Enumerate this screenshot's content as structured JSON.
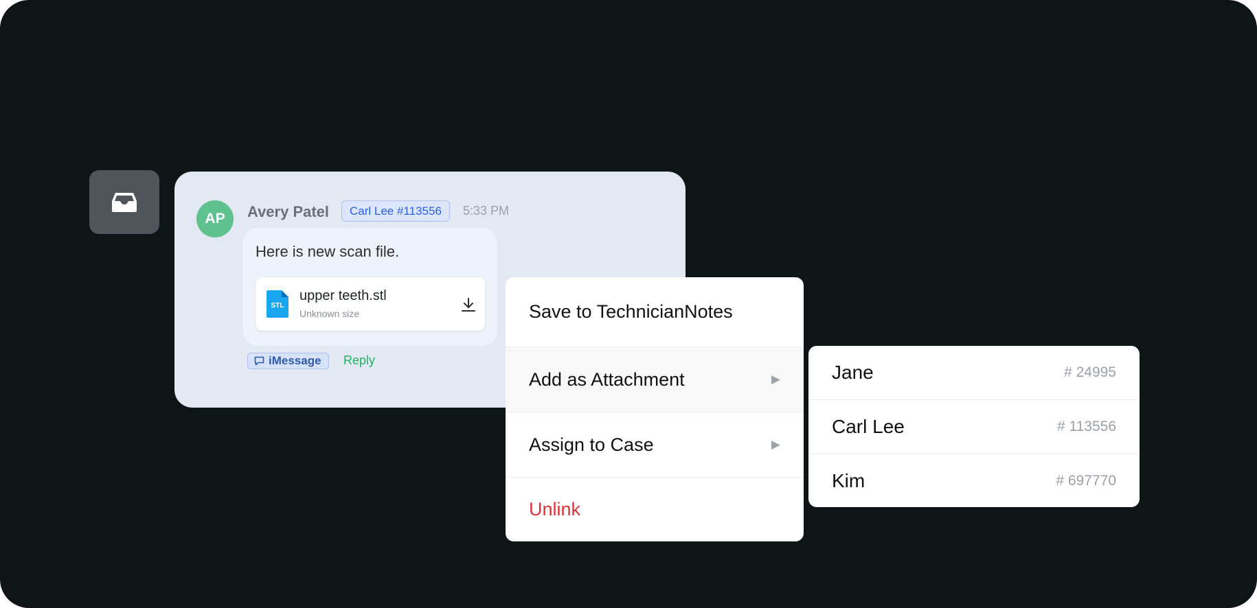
{
  "sidebar": {
    "icon": "inbox-tray-icon"
  },
  "message": {
    "avatar_initials": "AP",
    "sender": "Avery Patel",
    "case_tag": "Carl Lee #113556",
    "time": "5:33 PM",
    "text": "Here is new scan file.",
    "attachment": {
      "type_label": "STL",
      "name": "upper teeth.stl",
      "size": "Unknown size"
    },
    "channel": "iMessage",
    "reply_label": "Reply"
  },
  "context_menu": {
    "items": [
      {
        "label": "Save to TechnicianNotes",
        "has_submenu": false
      },
      {
        "label": "Add as Attachment",
        "has_submenu": true
      },
      {
        "label": "Assign to Case",
        "has_submenu": true
      },
      {
        "label": "Unlink",
        "has_submenu": false,
        "danger": true
      }
    ]
  },
  "submenu": {
    "items": [
      {
        "name": "Jane",
        "number": "# 24995"
      },
      {
        "name": "Carl Lee",
        "number": "# 113556"
      },
      {
        "name": "Kim",
        "number": "# 697770"
      }
    ]
  },
  "colors": {
    "background": "#0f1516",
    "card": "#e3e8f2",
    "avatar": "#5fc18e",
    "tag_text": "#2e5fdb",
    "reply": "#23b15e",
    "danger": "#d9343a",
    "file_icon": "#1aa7f0"
  }
}
